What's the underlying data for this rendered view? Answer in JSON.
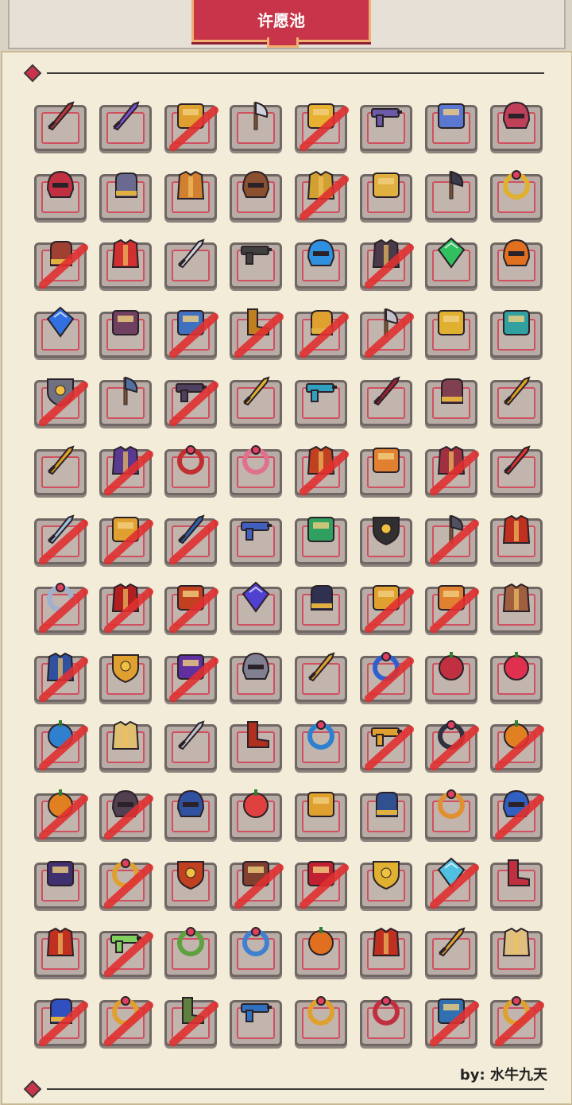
{
  "title": "许愿池",
  "credit": "by:  水牛九天",
  "colors": {
    "strike": "#e03030",
    "banner": "#c8354a",
    "panel": "#f3ecd8"
  },
  "grid": {
    "columns": 8,
    "items": [
      {
        "icon": "sword-icon",
        "color": "#b83a3a",
        "crossed": false
      },
      {
        "icon": "sword-icon",
        "color": "#7b4fc9",
        "crossed": false
      },
      {
        "icon": "gear-icon",
        "color": "#e0a030",
        "crossed": true
      },
      {
        "icon": "axe-icon",
        "color": "#d0d0d8",
        "crossed": false
      },
      {
        "icon": "wing-icon",
        "color": "#e8b030",
        "crossed": true
      },
      {
        "icon": "gun-icon",
        "color": "#6a5aa8",
        "crossed": false
      },
      {
        "icon": "crosshair-icon",
        "color": "#5a78d0",
        "crossed": false
      },
      {
        "icon": "mask-icon",
        "color": "#c0405a",
        "crossed": false
      },
      {
        "icon": "helmet-icon",
        "color": "#c03040",
        "crossed": false
      },
      {
        "icon": "gauntlet-icon",
        "color": "#6a6a90",
        "crossed": false
      },
      {
        "icon": "armor-icon",
        "color": "#d08030",
        "crossed": false
      },
      {
        "icon": "helmet-icon",
        "color": "#8a5030",
        "crossed": false
      },
      {
        "icon": "armor-icon",
        "color": "#d0a030",
        "crossed": true
      },
      {
        "icon": "coins-icon",
        "color": "#e0b040",
        "crossed": false
      },
      {
        "icon": "scythe-icon",
        "color": "#3a3a4a",
        "crossed": false
      },
      {
        "icon": "ring-icon",
        "color": "#e0b030",
        "crossed": false
      },
      {
        "icon": "glove-icon",
        "color": "#a04030",
        "crossed": true
      },
      {
        "icon": "armor-icon",
        "color": "#d03030",
        "crossed": false
      },
      {
        "icon": "dagger-icon",
        "color": "#d0d0d8",
        "crossed": false
      },
      {
        "icon": "rifle-icon",
        "color": "#404040",
        "crossed": false
      },
      {
        "icon": "helmet-icon",
        "color": "#3090e0",
        "crossed": false
      },
      {
        "icon": "armor-icon",
        "color": "#4a3a4a",
        "crossed": true
      },
      {
        "icon": "gem-icon",
        "color": "#30c060",
        "crossed": false
      },
      {
        "icon": "helmet-icon",
        "color": "#e07020",
        "crossed": false
      },
      {
        "icon": "diamond-icon",
        "color": "#3070e0",
        "crossed": false
      },
      {
        "icon": "chest-icon",
        "color": "#704060",
        "crossed": false
      },
      {
        "icon": "battery-icon",
        "color": "#4070c0",
        "crossed": true
      },
      {
        "icon": "boots-icon",
        "color": "#c08020",
        "crossed": true
      },
      {
        "icon": "gloves-icon",
        "color": "#e0a030",
        "crossed": true
      },
      {
        "icon": "axe-icon",
        "color": "#c0c0c8",
        "crossed": true
      },
      {
        "icon": "key-icon",
        "color": "#e0b030",
        "crossed": false
      },
      {
        "icon": "bow-icon",
        "color": "#30a0a0",
        "crossed": false
      },
      {
        "icon": "shield-icon",
        "color": "#707080",
        "crossed": true
      },
      {
        "icon": "hammer-icon",
        "color": "#5070a0",
        "crossed": false
      },
      {
        "icon": "gun-icon",
        "color": "#504060",
        "crossed": true
      },
      {
        "icon": "spear-icon",
        "color": "#e0b030",
        "crossed": false
      },
      {
        "icon": "crossbow-icon",
        "color": "#30a0c0",
        "crossed": false
      },
      {
        "icon": "sword-icon",
        "color": "#a02030",
        "crossed": false
      },
      {
        "icon": "fist-icon",
        "color": "#804050",
        "crossed": false
      },
      {
        "icon": "blade-icon",
        "color": "#e0a020",
        "crossed": false
      },
      {
        "icon": "blade-icon",
        "color": "#e0a020",
        "crossed": false
      },
      {
        "icon": "armor-icon",
        "color": "#5a3a90",
        "crossed": true
      },
      {
        "icon": "belt-icon",
        "color": "#c03030",
        "crossed": false
      },
      {
        "icon": "necklace-icon",
        "color": "#e07090",
        "crossed": false
      },
      {
        "icon": "cape-icon",
        "color": "#c04020",
        "crossed": true
      },
      {
        "icon": "chest-icon",
        "color": "#e08030",
        "crossed": false
      },
      {
        "icon": "armor-icon",
        "color": "#a03040",
        "crossed": true
      },
      {
        "icon": "lightsaber-icon",
        "color": "#e03030",
        "crossed": false
      },
      {
        "icon": "blade-icon",
        "color": "#a0c0e0",
        "crossed": true
      },
      {
        "icon": "fish-icon",
        "color": "#e0a030",
        "crossed": true
      },
      {
        "icon": "swordfish-icon",
        "color": "#3060b0",
        "crossed": true
      },
      {
        "icon": "blaster-icon",
        "color": "#4060c0",
        "crossed": false
      },
      {
        "icon": "goggles-icon",
        "color": "#30a060",
        "crossed": false
      },
      {
        "icon": "shield-icon",
        "color": "#303030",
        "crossed": false
      },
      {
        "icon": "scythe-icon",
        "color": "#505060",
        "crossed": true
      },
      {
        "icon": "armor-icon",
        "color": "#c03020",
        "crossed": false
      },
      {
        "icon": "necklace-icon",
        "color": "#a0b0d0",
        "crossed": true
      },
      {
        "icon": "cape-icon",
        "color": "#b02020",
        "crossed": true
      },
      {
        "icon": "torch-icon",
        "color": "#c04020",
        "crossed": true
      },
      {
        "icon": "orb-icon",
        "color": "#5040d0",
        "crossed": false
      },
      {
        "icon": "gauntlet-icon",
        "color": "#303050",
        "crossed": false
      },
      {
        "icon": "staff-icon",
        "color": "#e0a030",
        "crossed": true
      },
      {
        "icon": "staff-icon",
        "color": "#e08030",
        "crossed": true
      },
      {
        "icon": "vest-icon",
        "color": "#a06040",
        "crossed": false
      },
      {
        "icon": "cape-icon",
        "color": "#3050a0",
        "crossed": true
      },
      {
        "icon": "crown-icon",
        "color": "#e0a030",
        "crossed": false
      },
      {
        "icon": "wing-icon",
        "color": "#6030a0",
        "crossed": true
      },
      {
        "icon": "helmet-icon",
        "color": "#808090",
        "crossed": false
      },
      {
        "icon": "spear-icon",
        "color": "#e0a030",
        "crossed": false
      },
      {
        "icon": "ring-icon",
        "color": "#3060d0",
        "crossed": true
      },
      {
        "icon": "clock-icon",
        "color": "#c03040",
        "crossed": false
      },
      {
        "icon": "lollipop-icon",
        "color": "#e03050",
        "crossed": false
      },
      {
        "icon": "anchor-icon",
        "color": "#3080d0",
        "crossed": true
      },
      {
        "icon": "robe-icon",
        "color": "#e0c070",
        "crossed": false
      },
      {
        "icon": "sword-icon",
        "color": "#c0c0c8",
        "crossed": false
      },
      {
        "icon": "boots-icon",
        "color": "#b03020",
        "crossed": false
      },
      {
        "icon": "ring-icon",
        "color": "#3080d0",
        "crossed": false
      },
      {
        "icon": "gun-icon",
        "color": "#e0a030",
        "crossed": true
      },
      {
        "icon": "amulet-icon",
        "color": "#303040",
        "crossed": true
      },
      {
        "icon": "pumpkin-icon",
        "color": "#e08020",
        "crossed": true
      },
      {
        "icon": "fruit-icon",
        "color": "#e08020",
        "crossed": true
      },
      {
        "icon": "helmet-icon",
        "color": "#504050",
        "crossed": true
      },
      {
        "icon": "helmet-icon",
        "color": "#3050a0",
        "crossed": false
      },
      {
        "icon": "candy-icon",
        "color": "#e04040",
        "crossed": false
      },
      {
        "icon": "barrel-icon",
        "color": "#e0a030",
        "crossed": false
      },
      {
        "icon": "gauntlet-icon",
        "color": "#305090",
        "crossed": false
      },
      {
        "icon": "belt-icon",
        "color": "#e09030",
        "crossed": false
      },
      {
        "icon": "helmet-icon",
        "color": "#3060c0",
        "crossed": true
      },
      {
        "icon": "piano-icon",
        "color": "#403070",
        "crossed": false
      },
      {
        "icon": "ring-icon",
        "color": "#e0a030",
        "crossed": true
      },
      {
        "icon": "shield-icon",
        "color": "#c04020",
        "crossed": false
      },
      {
        "icon": "cube-icon",
        "color": "#804030",
        "crossed": true
      },
      {
        "icon": "staff-icon",
        "color": "#c02030",
        "crossed": true
      },
      {
        "icon": "crown-icon",
        "color": "#e0b030",
        "crossed": false
      },
      {
        "icon": "crystal-icon",
        "color": "#50c0e0",
        "crossed": true
      },
      {
        "icon": "boots-icon",
        "color": "#c03040",
        "crossed": false
      },
      {
        "icon": "cape-icon",
        "color": "#c03020",
        "crossed": false
      },
      {
        "icon": "gun-icon",
        "color": "#80d060",
        "crossed": true
      },
      {
        "icon": "ring-icon",
        "color": "#60a040",
        "crossed": false
      },
      {
        "icon": "ring-icon",
        "color": "#4080d0",
        "crossed": false
      },
      {
        "icon": "pumpkin-icon",
        "color": "#e07020",
        "crossed": false
      },
      {
        "icon": "armor-icon",
        "color": "#c03020",
        "crossed": false
      },
      {
        "icon": "spear-icon",
        "color": "#e0a030",
        "crossed": false
      },
      {
        "icon": "robe-icon",
        "color": "#e0c080",
        "crossed": false
      },
      {
        "icon": "gauntlet-icon",
        "color": "#3050c0",
        "crossed": true
      },
      {
        "icon": "wreath-icon",
        "color": "#e0a030",
        "crossed": true
      },
      {
        "icon": "boots-icon",
        "color": "#608040",
        "crossed": true
      },
      {
        "icon": "blaster-icon",
        "color": "#3070c0",
        "crossed": false
      },
      {
        "icon": "necklace-icon",
        "color": "#e0a030",
        "crossed": false
      },
      {
        "icon": "belt-icon",
        "color": "#c03040",
        "crossed": false
      },
      {
        "icon": "scroll-icon",
        "color": "#3070b0",
        "crossed": true
      },
      {
        "icon": "ring-icon",
        "color": "#e0a030",
        "crossed": true
      }
    ]
  }
}
